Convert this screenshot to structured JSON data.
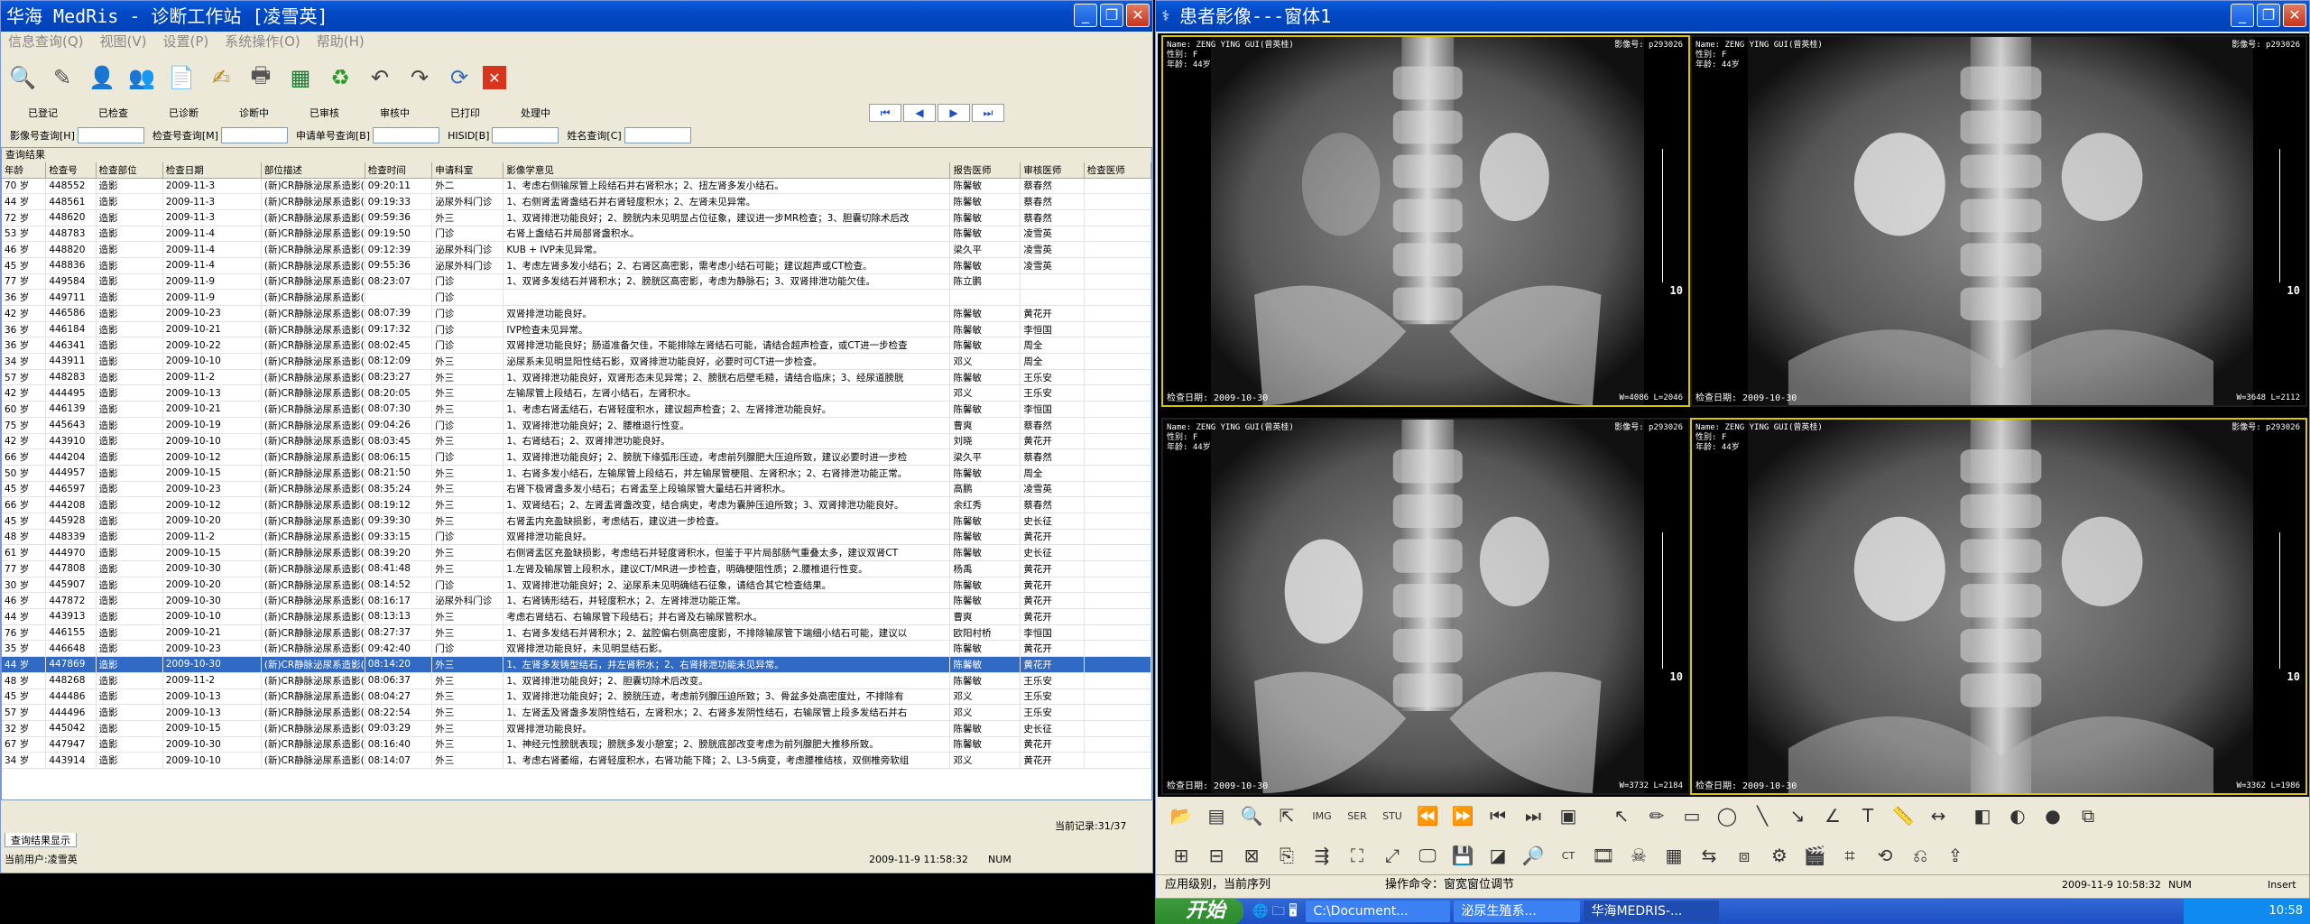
{
  "left_window": {
    "title": "华海 MedRis - 诊断工作站 [凌雪英]",
    "menu": [
      "信息查询(Q)",
      "视图(V)",
      "设置(P)",
      "系统操作(O)",
      "帮助(H)"
    ],
    "status_tabs": [
      "已登记",
      "已检查",
      "已诊断",
      "诊断中",
      "已审核",
      "审核中",
      "已打印",
      "处理中"
    ],
    "query": {
      "f1": "影像号查询[H]",
      "f2": "检查号查询[M]",
      "f3": "申请单号查询[B]",
      "f4": "HISID[B]",
      "f5": "姓名查询[C]"
    },
    "results_caption": "查询结果",
    "columns": [
      "年龄",
      "检查号",
      "检查部位",
      "检查日期",
      "部位描述",
      "检查时间",
      "申请科室",
      "影像学意见",
      "报告医师",
      "审核医师",
      "检查医师"
    ],
    "rows": [
      [
        "70 岁",
        "448552",
        "造影",
        "2009-11-3",
        "(新)CR静脉泌尿系造影(",
        "09:20:11",
        "外二",
        "1、考虑右侧输尿管上段结石并右肾积水；2、扭左肾多发小结石。",
        "陈馨敏",
        "蔡春然"
      ],
      [
        "44 岁",
        "448561",
        "造影",
        "2009-11-3",
        "(新)CR静脉泌尿系造影(",
        "09:19:33",
        "泌尿外科门诊",
        "1、右侧肾盂肾盏结石并右肾轻度积水；2、左肾未见异常。",
        "陈馨敏",
        "蔡春然"
      ],
      [
        "72 岁",
        "448620",
        "造影",
        "2009-11-3",
        "(新)CR静脉泌尿系造影(",
        "09:59:36",
        "外三",
        "1、双肾排泄功能良好；2、膀胱内未见明显占位征象，建议进一步MR检查；3、胆囊切除术后改",
        "陈馨敏",
        "蔡春然"
      ],
      [
        "53 岁",
        "448783",
        "造影",
        "2009-11-4",
        "(新)CR静脉泌尿系造影(",
        "09:19:50",
        "门诊",
        "右肾上盏结石并局部肾盏积水。",
        "陈馨敏",
        "凌雪英"
      ],
      [
        "46 岁",
        "448820",
        "造影",
        "2009-11-4",
        "(新)CR静脉泌尿系造影(",
        "09:12:39",
        "泌尿外科门诊",
        "KUB + IVP未见异常。",
        "梁久平",
        "凌雪英"
      ],
      [
        "45 岁",
        "448836",
        "造影",
        "2009-11-4",
        "(新)CR静脉泌尿系造影(",
        "09:55:36",
        "泌尿外科门诊",
        "1、考虑左肾多发小结石；2、右肾区高密影，需考虑小结石可能；建议超声或CT检查。",
        "陈馨敏",
        "凌雪英"
      ],
      [
        "77 岁",
        "449584",
        "造影",
        "2009-11-9",
        "(新)CR静脉泌尿系造影(",
        "08:23:07",
        "门诊",
        "1、双肾多发结石并肾积水；2、膀胱区高密影，考虑为静脉石；3、双肾排泄功能欠佳。",
        "陈立鹏",
        ""
      ],
      [
        "36 岁",
        "449711",
        "造影",
        "2009-11-9",
        "(新)CR静脉泌尿系造影(",
        "",
        "门诊",
        "",
        "",
        ""
      ],
      [
        "42 岁",
        "446586",
        "造影",
        "2009-10-23",
        "(新)CR静脉泌尿系造影(",
        "08:07:39",
        "门诊",
        "双肾排泄功能良好。",
        "陈馨敏",
        "黄花开"
      ],
      [
        "36 岁",
        "446184",
        "造影",
        "2009-10-21",
        "(新)CR静脉泌尿系造影(",
        "09:17:32",
        "门诊",
        "IVP检查未见异常。",
        "陈馨敏",
        "李恒国"
      ],
      [
        "36 岁",
        "446341",
        "造影",
        "2009-10-22",
        "(新)CR静脉泌尿系造影(",
        "08:02:45",
        "门诊",
        "双肾排泄功能良好；肠道准备欠佳，不能排除左肾结石可能，请结合超声检查，或CT进一步检查",
        "陈馨敏",
        "周全"
      ],
      [
        "34 岁",
        "443911",
        "造影",
        "2009-10-10",
        "(新)CR静脉泌尿系造影(",
        "08:12:09",
        "外三",
        "泌尿系未见明显阳性结石影，双肾排泄功能良好，必要时可CT进一步检查。",
        "邓义",
        "周全"
      ],
      [
        "57 岁",
        "448283",
        "造影",
        "2009-11-2",
        "(新)CR静脉泌尿系造影(",
        "08:23:27",
        "外三",
        "1、双肾排泄功能良好，双肾形态未见异常；2、膀胱右后壁毛糙，请结合临床；3、经尿道膀胱",
        "陈馨敏",
        "王乐安"
      ],
      [
        "42 岁",
        "444495",
        "造影",
        "2009-10-13",
        "(新)CR静脉泌尿系造影(",
        "08:20:05",
        "外三",
        "左输尿管上段结石，左肾小结石，左肾积水。",
        "邓义",
        "王乐安"
      ],
      [
        "60 岁",
        "446139",
        "造影",
        "2009-10-21",
        "(新)CR静脉泌尿系造影(",
        "08:07:30",
        "外三",
        "1、考虑右肾盂结石，右肾轻度积水，建议超声检查；2、左肾排泄功能良好。",
        "陈馨敏",
        "李恒国"
      ],
      [
        "75 岁",
        "445643",
        "造影",
        "2009-10-19",
        "(新)CR静脉泌尿系造影(",
        "09:04:26",
        "门诊",
        "1、双肾排泄功能良好；2、腰椎退行性变。",
        "曹爽",
        "蔡春然"
      ],
      [
        "42 岁",
        "443910",
        "造影",
        "2009-10-10",
        "(新)CR静脉泌尿系造影(",
        "08:03:45",
        "外三",
        "1、右肾结石；2、双肾排泄功能良好。",
        "刘晓",
        "黄花开"
      ],
      [
        "66 岁",
        "444204",
        "造影",
        "2009-10-12",
        "(新)CR静脉泌尿系造影(",
        "08:06:15",
        "门诊",
        "1、双肾排泄功能良好；2、膀胱下缘弧形压迹，考虑前列腺肥大压迫所致，建议必要时进一步检",
        "梁久平",
        "蔡春然"
      ],
      [
        "50 岁",
        "444957",
        "造影",
        "2009-10-15",
        "(新)CR静脉泌尿系造影(",
        "08:21:50",
        "外三",
        "1、右肾多发小结石，左输尿管上段结石，并左输尿管梗阻、左肾积水；2、右肾排泄功能正常。",
        "陈馨敏",
        "周全"
      ],
      [
        "45 岁",
        "446597",
        "造影",
        "2009-10-23",
        "(新)CR静脉泌尿系造影(",
        "08:35:24",
        "外三",
        "右肾下极肾盏多发小结石；右肾盂至上段输尿管大量结石并肾积水。",
        "高鹏",
        "凌雪英"
      ],
      [
        "66 岁",
        "444208",
        "造影",
        "2009-10-12",
        "(新)CR静脉泌尿系造影(",
        "08:19:12",
        "外三",
        "1、双肾结石；2、左肾盂肾盏改变，结合病史，考虑为囊肿压迫所致；3、双肾排泄功能良好。",
        "余红秀",
        "蔡春然"
      ],
      [
        "45 岁",
        "445928",
        "造影",
        "2009-10-20",
        "(新)CR静脉泌尿系造影(",
        "09:39:30",
        "外三",
        "右肾盂内充盈缺损影，考虑结石，建议进一步检查。",
        "陈馨敏",
        "史长征"
      ],
      [
        "48 岁",
        "448339",
        "造影",
        "2009-11-2",
        "(新)CR静脉泌尿系造影(",
        "09:33:15",
        "门诊",
        "双肾排泄功能良好。",
        "陈馨敏",
        "黄花开"
      ],
      [
        "61 岁",
        "444970",
        "造影",
        "2009-10-15",
        "(新)CR静脉泌尿系造影(",
        "08:39:20",
        "外三",
        "右侧肾盂区充盈缺损影，考虑结石并轻度肾积水，但鉴于平片局部肠气重叠太多，建议双肾CT",
        "陈馨敏",
        "史长征"
      ],
      [
        "77 岁",
        "447808",
        "造影",
        "2009-10-30",
        "(新)CR静脉泌尿系造影(",
        "08:41:48",
        "外三",
        "1.左肾及输尿管上段积水，建议CT/MR进一步检查，明确梗阻性质；2.腰椎退行性变。",
        "杨禹",
        "黄花开"
      ],
      [
        "30 岁",
        "445907",
        "造影",
        "2009-10-20",
        "(新)CR静脉泌尿系造影(",
        "08:14:52",
        "门诊",
        "1、双肾排泄功能良好；2、泌尿系未见明确结石征象，请结合其它检查结果。",
        "陈馨敏",
        "黄花开"
      ],
      [
        "46 岁",
        "447872",
        "造影",
        "2009-10-30",
        "(新)CR静脉泌尿系造影(",
        "08:16:17",
        "泌尿外科门诊",
        "1、右肾铸形结石，并轻度积水；2、左肾排泄功能正常。",
        "陈馨敏",
        "黄花开"
      ],
      [
        "44 岁",
        "443913",
        "造影",
        "2009-10-10",
        "(新)CR静脉泌尿系造影(",
        "08:13:13",
        "外三",
        "考虑右肾结石、右输尿管下段结石；并右肾及右输尿管积水。",
        "曹爽",
        "黄花开"
      ],
      [
        "76 岁",
        "446155",
        "造影",
        "2009-10-21",
        "(新)CR静脉泌尿系造影(",
        "08:27:37",
        "外三",
        "1、右肾多发结石并肾积水；2、盆腔偏右侧高密度影，不排除输尿管下端细小结石可能，建议以",
        "欧阳村桥",
        "李恒国"
      ],
      [
        "35 岁",
        "446648",
        "造影",
        "2009-10-23",
        "(新)CR静脉泌尿系造影(",
        "09:42:40",
        "门诊",
        "双肾排泄功能良好，未见明显结石影。",
        "陈馨敏",
        "黄花开"
      ],
      [
        "44 岁",
        "447869",
        "造影",
        "2009-10-30",
        "(新)CR静脉泌尿系造影(",
        "08:14:20",
        "外三",
        "1、左肾多发铸型结石，并左肾积水；2、右肾排泄功能未见异常。",
        "陈馨敏",
        "黄花开"
      ],
      [
        "48 岁",
        "448268",
        "造影",
        "2009-11-2",
        "(新)CR静脉泌尿系造影(",
        "08:06:37",
        "外三",
        "1、双肾排泄功能良好；2、胆囊切除术后改变。",
        "陈馨敏",
        "王乐安"
      ],
      [
        "45 岁",
        "444486",
        "造影",
        "2009-10-13",
        "(新)CR静脉泌尿系造影(",
        "08:04:27",
        "外三",
        "1、双肾排泄功能良好；2、膀胱压迹，考虑前列腺压迫所致；3、骨盆多处高密度灶，不排除有",
        "邓义",
        "王乐安"
      ],
      [
        "57 岁",
        "444496",
        "造影",
        "2009-10-13",
        "(新)CR静脉泌尿系造影(",
        "08:22:54",
        "外三",
        "1、左肾盂及肾盏多发阴性结石，左肾积水；2、右肾多发阴性结石，右输尿管上段多发结石并右",
        "邓义",
        "王乐安"
      ],
      [
        "32 岁",
        "445042",
        "造影",
        "2009-10-15",
        "(新)CR静脉泌尿系造影(",
        "09:03:29",
        "外三",
        "双肾排泄功能良好。",
        "陈馨敏",
        "史长征"
      ],
      [
        "67 岁",
        "447947",
        "造影",
        "2009-10-30",
        "(新)CR静脉泌尿系造影(",
        "08:16:40",
        "外三",
        "1、神经元性膀胱表现；膀胱多发小憩室；2、膀胱底部改变考虑为前列腺肥大推移所致。",
        "陈馨敏",
        "黄花开"
      ],
      [
        "34 岁",
        "443914",
        "造影",
        "2009-10-10",
        "(新)CR静脉泌尿系造影(",
        "08:14:07",
        "外三",
        "1、考虑右肾萎缩，右肾轻度积水，右肾功能下降；2、L3-5病变，考虑腰椎结核，双侧椎旁软组",
        "邓义",
        "黄花开"
      ]
    ],
    "selected_row": 30,
    "record_count": "当前记录:31/37",
    "bottom_tab": "查询结果显示",
    "current_user": "当前用户:凌雪英",
    "datetime": "2009-11-9 11:58:32",
    "caps": "NUM"
  },
  "right_window": {
    "title": "患者影像---窗体1",
    "images": [
      {
        "name": "Name: ZENG YING GUI(曾英桂)",
        "sex": "性别: F",
        "age": "年龄: 44岁",
        "id": "影像号: p293026",
        "date": "检查日期: 2009-10-30",
        "wl": "W=4086 L=2046",
        "mark": "10"
      },
      {
        "name": "Name: ZENG YING GUI(曾英桂)",
        "sex": "性别: F",
        "age": "年龄: 44岁",
        "id": "影像号: p293026",
        "date": "检查日期: 2009-10-30",
        "wl": "W=3648 L=2112",
        "mark": "10"
      },
      {
        "name": "Name: ZENG YING GUI(曾英桂)",
        "sex": "性别: F",
        "age": "年龄: 44岁",
        "id": "影像号: p293026",
        "date": "检查日期: 2009-10-30",
        "wl": "W=3732 L=2184",
        "mark": "10"
      },
      {
        "name": "Name: ZENG YING GUI(曾英桂)",
        "sex": "性别: F",
        "age": "年龄: 44岁",
        "id": "影像号: p293026",
        "date": "检查日期: 2009-10-30",
        "wl": "W=3362 L=1986",
        "mark": "10"
      }
    ],
    "status_left": "应用级别，当前序列",
    "status_mid": "操作命令：窗宽窗位调节",
    "status_date": "2009-11-9 10:58:32",
    "status_num": "NUM",
    "status_ins": "Insert"
  },
  "taskbar": {
    "start": "开始",
    "items": [
      "C:\\Document...",
      "泌尿生殖系...",
      "华海MEDRIS-..."
    ],
    "clock": "10:58"
  }
}
